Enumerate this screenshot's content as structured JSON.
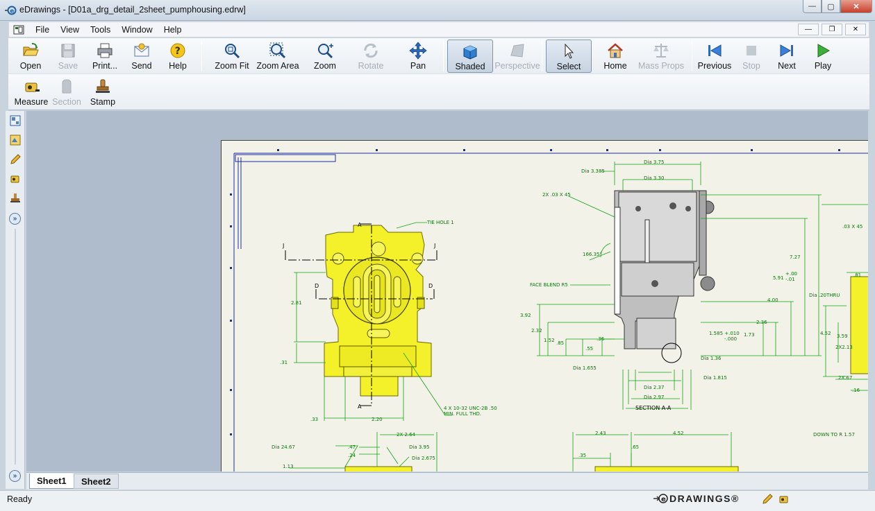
{
  "window": {
    "title": "eDrawings - [D01a_drg_detail_2sheet_pumphousing.edrw]",
    "minimize": "—",
    "maximize": "▢",
    "close": "✕"
  },
  "menu": {
    "items": [
      "File",
      "View",
      "Tools",
      "Window",
      "Help"
    ],
    "doc_minimize": "—",
    "doc_restore": "❐",
    "doc_close": "✕"
  },
  "toolbar": {
    "open": "Open",
    "save": "Save",
    "print": "Print...",
    "send": "Send",
    "help": "Help",
    "zoom_fit": "Zoom Fit",
    "zoom_area": "Zoom Area",
    "zoom": "Zoom",
    "rotate": "Rotate",
    "pan": "Pan",
    "shaded": "Shaded",
    "perspective": "Perspective",
    "select": "Select",
    "home": "Home",
    "mass_props": "Mass Props",
    "previous": "Previous",
    "stop": "Stop",
    "next": "Next",
    "play": "Play",
    "measure": "Measure",
    "section": "Section",
    "stamp": "Stamp"
  },
  "drawing": {
    "labels": {
      "tie_hole": "TIE HOLE 1",
      "a_top": "A",
      "a_bottom": "A",
      "j_left": "J",
      "j_right": "J",
      "d_left": "D",
      "d_right": "D",
      "d281": "2.81",
      "d31": ".31",
      "d33": ".33",
      "d220": "2.20",
      "thread1": "4 X 10-32 UNC-2B .50",
      "thread2": "MIN. FULL THD.",
      "dia375": "Dia 3.75",
      "dia3385": "Dia 3.385",
      "dia330": "Dia 3.30",
      "chamfer": "2X .03 X 45",
      "angle": "166.35°",
      "face_blend": "FACE BLEND R5",
      "d392": "3.92",
      "d232": "2.32",
      "d152": "1.52",
      "d85": ".85",
      "d36": ".36",
      "d55": ".55",
      "d1585a": "1.585 +.010",
      "d1585b": "-.000",
      "d173": "1.73",
      "d236": "2.36",
      "d400": "4.00",
      "d591": "5.91",
      "tol1": "+.00",
      "tol2": "-.01",
      "d727": "7.27",
      "dia136": "Dia 1.36",
      "dia1655": "Dia 1.655",
      "dia1815": "Dia 1.815",
      "dia237": "Dia 2.37",
      "dia297": "Dia 2.97",
      "section": "SECTION A-A",
      "chamfer2": ".03 X 45",
      "d81": ".81",
      "dia20": "Dia .20THRU",
      "d452": "4.52",
      "d359": "3.59",
      "d2x213": "2X2.13",
      "d2x67": "2X.67",
      "d16": ".16",
      "dia2467": "Dia 24.67",
      "d47": ".47",
      "d24": ".24",
      "d2x264": "2X 2.64",
      "dia395": "Dia 3.95",
      "dia2675": "Dia 2.675",
      "d113": "1.13",
      "d243": "2.43",
      "d452b": "4.52",
      "d35": ".35",
      "d65": ".65",
      "downto": "DOWN TO R 1.57"
    }
  },
  "tabs": [
    "Sheet1",
    "Sheet2"
  ],
  "status": {
    "text": "Ready",
    "brand": "DRAWINGS®"
  }
}
